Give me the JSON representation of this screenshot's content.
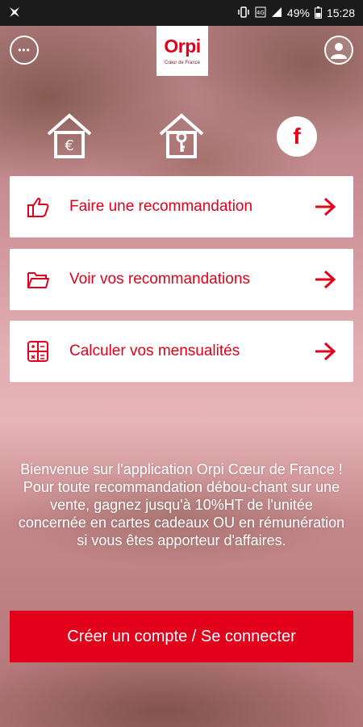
{
  "status_bar": {
    "battery": "49%",
    "time": "15:28",
    "icons": [
      "app-notification-icon",
      "vibrate-icon",
      "4g-icon",
      "signal-icon",
      "battery-icon"
    ]
  },
  "header": {
    "logo_word": "Orpi",
    "logo_sub": "Cœur de France",
    "menu_icon": "dots-circle-icon",
    "profile_icon": "user-circle-icon"
  },
  "shortcuts": {
    "sell_icon": "euro-house-icon",
    "buy_icon": "key-house-icon",
    "facebook_icon": "facebook-icon",
    "facebook_glyph": "f"
  },
  "menu": [
    {
      "label": "Faire une recommandation",
      "icon": "thumbs-up-icon"
    },
    {
      "label": "Voir vos recommandations",
      "icon": "folder-open-icon"
    },
    {
      "label": "Calculer vos mensualités",
      "icon": "calculator-icon"
    }
  ],
  "welcome": {
    "line1": "Bienvenue sur l'application Orpi Cœur de France !",
    "line2": "Pour toute recommandation débou-chant sur une vente, gagnez jusqu'à 10%HT de l'unitée concernée en cartes cadeaux OU en rémunération si vous êtes apporteur d'affaires."
  },
  "cta_label": "Créer un compte / Se connecter",
  "colors": {
    "brand_red": "#e2001a",
    "white": "#ffffff"
  }
}
